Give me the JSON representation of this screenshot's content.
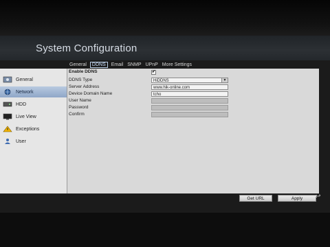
{
  "window": {
    "title": "System Configuration"
  },
  "tabs": [
    {
      "label": "General"
    },
    {
      "label": "DDNS",
      "active": true
    },
    {
      "label": "Email"
    },
    {
      "label": "SNMP"
    },
    {
      "label": "UPnP"
    },
    {
      "label": "More Settings"
    }
  ],
  "sidebar": {
    "items": [
      {
        "label": "General",
        "icon": "gear-icon"
      },
      {
        "label": "Network",
        "icon": "network-icon",
        "active": true
      },
      {
        "label": "HDD",
        "icon": "hdd-icon"
      },
      {
        "label": "Live View",
        "icon": "monitor-icon"
      },
      {
        "label": "Exceptions",
        "icon": "warning-icon"
      },
      {
        "label": "User",
        "icon": "user-icon"
      }
    ]
  },
  "form": {
    "enable_ddns": {
      "label": "Enable DDNS",
      "checked": true,
      "mark": "✔"
    },
    "ddns_type": {
      "label": "DDNS Type",
      "value": "HiDDNS"
    },
    "server_address": {
      "label": "Server Address",
      "value": "www.hik-online.com"
    },
    "device_domain_name": {
      "label": "Device Domain Name",
      "value": "tcho"
    },
    "user_name": {
      "label": "User Name",
      "value": ""
    },
    "password": {
      "label": "Password",
      "value": ""
    },
    "confirm": {
      "label": "Confirm",
      "value": ""
    }
  },
  "footer": {
    "get_url_label": "Get URL",
    "apply_label": "Apply",
    "back_icon": "back-arrow-icon"
  },
  "colors": {
    "active_tab_border": "#bcd0e8",
    "sidebar_active": "#8fa7c8"
  }
}
